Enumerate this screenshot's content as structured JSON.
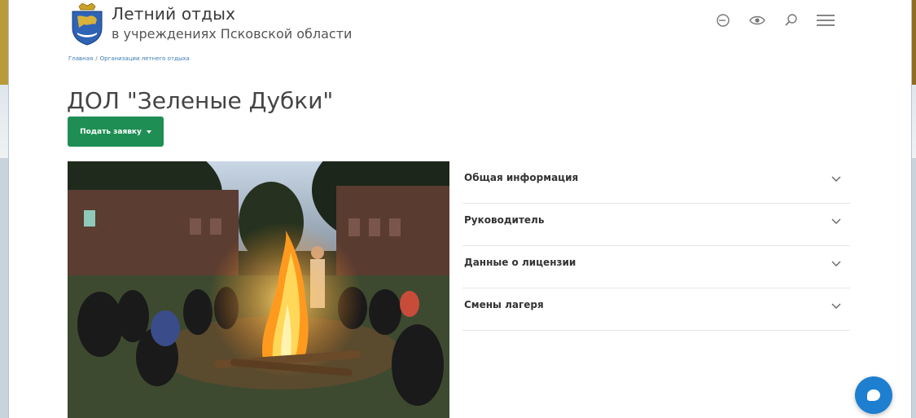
{
  "header": {
    "title": "Летний отдых",
    "subtitle": "в учреждениях Псковской области",
    "icons": [
      "login-icon",
      "eye-icon",
      "search-icon",
      "menu-icon"
    ]
  },
  "breadcrumb": {
    "home": "Главная",
    "separator": "/",
    "section": "Организации летнего отдыха"
  },
  "page": {
    "title": "ДОЛ \"Зеленые Дубки\"",
    "apply_button": "Подать заявку"
  },
  "accordion": {
    "items": [
      {
        "label": "Общая информация"
      },
      {
        "label": "Руководитель"
      },
      {
        "label": "Данные о лицензии"
      },
      {
        "label": "Смены лагеря"
      }
    ]
  },
  "colors": {
    "accent_green": "#1e8e54",
    "link_blue": "#3b7db3",
    "chat_blue": "#1e7fd0"
  },
  "chat": {
    "icon": "chat-bubble-icon"
  }
}
